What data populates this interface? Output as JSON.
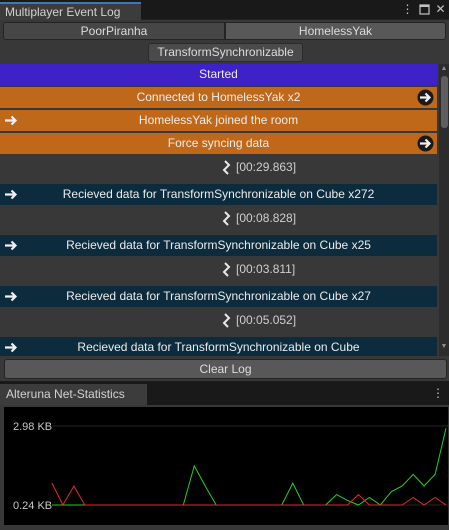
{
  "top_panel": {
    "tab_title": "Multiplayer Event Log",
    "menu_icon": "kebab-menu-icon",
    "maximize_icon": "maximize-icon",
    "close_icon": "close-icon",
    "peers": [
      "PoorPiranha",
      "HomelessYak"
    ],
    "selected_peer": "HomelessYak",
    "filter_label": "TransformSynchronizable",
    "clear_label": "Clear Log"
  },
  "log": {
    "entries": [
      {
        "kind": "event",
        "color": "purple",
        "text": "Started",
        "arrow": "none"
      },
      {
        "kind": "event",
        "color": "orange",
        "text": "Connected to HomelessYak x2",
        "arrow": "right"
      },
      {
        "kind": "event",
        "color": "orange",
        "text": "HomelessYak joined the room",
        "arrow": "left"
      },
      {
        "kind": "event",
        "color": "orange",
        "text": "Force syncing data",
        "arrow": "right"
      },
      {
        "kind": "gap",
        "text": "[00:29.863]"
      },
      {
        "kind": "event",
        "color": "navy",
        "text": "Recieved data for TransformSynchronizable on Cube x272",
        "arrow": "left"
      },
      {
        "kind": "gap",
        "text": "[00:08.828]"
      },
      {
        "kind": "event",
        "color": "navy",
        "text": "Recieved data for TransformSynchronizable on Cube x25",
        "arrow": "left"
      },
      {
        "kind": "gap",
        "text": "[00:03.811]"
      },
      {
        "kind": "event",
        "color": "navy",
        "text": "Recieved data for TransformSynchronizable on Cube x27",
        "arrow": "left"
      },
      {
        "kind": "gap",
        "text": "[00:05.052]"
      },
      {
        "kind": "event",
        "color": "navy",
        "text": "Recieved data for TransformSynchronizable on Cube",
        "arrow": "left"
      }
    ],
    "colors": {
      "purple": "#3f22c7",
      "orange": "#c0681a",
      "navy": "#0c2b3d"
    },
    "arrow_icon": "arrow-icon",
    "gap_icon": "time-gap-icon"
  },
  "bottom_panel": {
    "tab_title": "Alteruna Net-Statistics",
    "menu_icon": "kebab-menu-icon"
  },
  "chart_data": {
    "type": "line",
    "title": "",
    "xlabel": "",
    "ylabel": "",
    "y_ticks": [
      "2.98 KB",
      "0.24 KB"
    ],
    "ylim": [
      0,
      3.6
    ],
    "x": [
      0,
      1,
      2,
      3,
      4,
      5,
      6,
      7,
      8,
      9,
      10,
      11,
      12,
      13,
      14,
      15,
      16,
      17,
      18,
      19,
      20,
      21,
      22,
      23,
      24,
      25,
      26,
      27,
      28,
      29,
      30,
      31,
      32,
      33,
      34,
      35,
      36
    ],
    "series": [
      {
        "color": "#23d11f",
        "values": [
          0.24,
          0.24,
          0.24,
          0.24,
          0.24,
          0.24,
          0.24,
          0.24,
          0.24,
          0.24,
          0.24,
          0.24,
          0.24,
          1.6,
          0.9,
          0.24,
          0.24,
          0.24,
          0.24,
          0.24,
          0.24,
          0.24,
          1.0,
          0.24,
          0.24,
          0.24,
          0.6,
          0.4,
          0.24,
          0.5,
          0.24,
          0.7,
          0.9,
          1.3,
          0.9,
          1.3,
          2.9
        ]
      },
      {
        "color": "#e02a2a",
        "values": [
          1.0,
          0.24,
          0.9,
          0.24,
          0.24,
          0.24,
          0.24,
          0.24,
          0.24,
          0.24,
          0.24,
          0.24,
          0.24,
          0.24,
          0.24,
          0.24,
          0.24,
          0.24,
          0.24,
          0.24,
          0.24,
          0.24,
          0.24,
          0.24,
          0.24,
          0.24,
          0.24,
          0.24,
          0.6,
          0.24,
          0.24,
          0.24,
          0.24,
          0.5,
          0.24,
          0.5,
          0.24
        ]
      }
    ],
    "grid": false,
    "background": "#000000"
  }
}
